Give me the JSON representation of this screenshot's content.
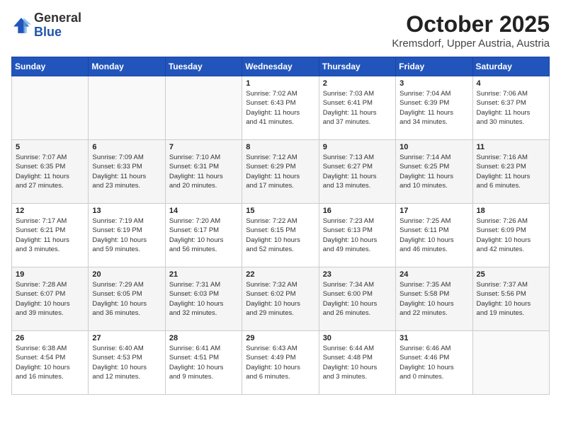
{
  "logo": {
    "general": "General",
    "blue": "Blue"
  },
  "title": "October 2025",
  "location": "Kremsdorf, Upper Austria, Austria",
  "days_of_week": [
    "Sunday",
    "Monday",
    "Tuesday",
    "Wednesday",
    "Thursday",
    "Friday",
    "Saturday"
  ],
  "weeks": [
    [
      {
        "day": "",
        "info": ""
      },
      {
        "day": "",
        "info": ""
      },
      {
        "day": "",
        "info": ""
      },
      {
        "day": "1",
        "info": "Sunrise: 7:02 AM\nSunset: 6:43 PM\nDaylight: 11 hours\nand 41 minutes."
      },
      {
        "day": "2",
        "info": "Sunrise: 7:03 AM\nSunset: 6:41 PM\nDaylight: 11 hours\nand 37 minutes."
      },
      {
        "day": "3",
        "info": "Sunrise: 7:04 AM\nSunset: 6:39 PM\nDaylight: 11 hours\nand 34 minutes."
      },
      {
        "day": "4",
        "info": "Sunrise: 7:06 AM\nSunset: 6:37 PM\nDaylight: 11 hours\nand 30 minutes."
      }
    ],
    [
      {
        "day": "5",
        "info": "Sunrise: 7:07 AM\nSunset: 6:35 PM\nDaylight: 11 hours\nand 27 minutes."
      },
      {
        "day": "6",
        "info": "Sunrise: 7:09 AM\nSunset: 6:33 PM\nDaylight: 11 hours\nand 23 minutes."
      },
      {
        "day": "7",
        "info": "Sunrise: 7:10 AM\nSunset: 6:31 PM\nDaylight: 11 hours\nand 20 minutes."
      },
      {
        "day": "8",
        "info": "Sunrise: 7:12 AM\nSunset: 6:29 PM\nDaylight: 11 hours\nand 17 minutes."
      },
      {
        "day": "9",
        "info": "Sunrise: 7:13 AM\nSunset: 6:27 PM\nDaylight: 11 hours\nand 13 minutes."
      },
      {
        "day": "10",
        "info": "Sunrise: 7:14 AM\nSunset: 6:25 PM\nDaylight: 11 hours\nand 10 minutes."
      },
      {
        "day": "11",
        "info": "Sunrise: 7:16 AM\nSunset: 6:23 PM\nDaylight: 11 hours\nand 6 minutes."
      }
    ],
    [
      {
        "day": "12",
        "info": "Sunrise: 7:17 AM\nSunset: 6:21 PM\nDaylight: 11 hours\nand 3 minutes."
      },
      {
        "day": "13",
        "info": "Sunrise: 7:19 AM\nSunset: 6:19 PM\nDaylight: 10 hours\nand 59 minutes."
      },
      {
        "day": "14",
        "info": "Sunrise: 7:20 AM\nSunset: 6:17 PM\nDaylight: 10 hours\nand 56 minutes."
      },
      {
        "day": "15",
        "info": "Sunrise: 7:22 AM\nSunset: 6:15 PM\nDaylight: 10 hours\nand 52 minutes."
      },
      {
        "day": "16",
        "info": "Sunrise: 7:23 AM\nSunset: 6:13 PM\nDaylight: 10 hours\nand 49 minutes."
      },
      {
        "day": "17",
        "info": "Sunrise: 7:25 AM\nSunset: 6:11 PM\nDaylight: 10 hours\nand 46 minutes."
      },
      {
        "day": "18",
        "info": "Sunrise: 7:26 AM\nSunset: 6:09 PM\nDaylight: 10 hours\nand 42 minutes."
      }
    ],
    [
      {
        "day": "19",
        "info": "Sunrise: 7:28 AM\nSunset: 6:07 PM\nDaylight: 10 hours\nand 39 minutes."
      },
      {
        "day": "20",
        "info": "Sunrise: 7:29 AM\nSunset: 6:05 PM\nDaylight: 10 hours\nand 36 minutes."
      },
      {
        "day": "21",
        "info": "Sunrise: 7:31 AM\nSunset: 6:03 PM\nDaylight: 10 hours\nand 32 minutes."
      },
      {
        "day": "22",
        "info": "Sunrise: 7:32 AM\nSunset: 6:02 PM\nDaylight: 10 hours\nand 29 minutes."
      },
      {
        "day": "23",
        "info": "Sunrise: 7:34 AM\nSunset: 6:00 PM\nDaylight: 10 hours\nand 26 minutes."
      },
      {
        "day": "24",
        "info": "Sunrise: 7:35 AM\nSunset: 5:58 PM\nDaylight: 10 hours\nand 22 minutes."
      },
      {
        "day": "25",
        "info": "Sunrise: 7:37 AM\nSunset: 5:56 PM\nDaylight: 10 hours\nand 19 minutes."
      }
    ],
    [
      {
        "day": "26",
        "info": "Sunrise: 6:38 AM\nSunset: 4:54 PM\nDaylight: 10 hours\nand 16 minutes."
      },
      {
        "day": "27",
        "info": "Sunrise: 6:40 AM\nSunset: 4:53 PM\nDaylight: 10 hours\nand 12 minutes."
      },
      {
        "day": "28",
        "info": "Sunrise: 6:41 AM\nSunset: 4:51 PM\nDaylight: 10 hours\nand 9 minutes."
      },
      {
        "day": "29",
        "info": "Sunrise: 6:43 AM\nSunset: 4:49 PM\nDaylight: 10 hours\nand 6 minutes."
      },
      {
        "day": "30",
        "info": "Sunrise: 6:44 AM\nSunset: 4:48 PM\nDaylight: 10 hours\nand 3 minutes."
      },
      {
        "day": "31",
        "info": "Sunrise: 6:46 AM\nSunset: 4:46 PM\nDaylight: 10 hours\nand 0 minutes."
      },
      {
        "day": "",
        "info": ""
      }
    ]
  ]
}
